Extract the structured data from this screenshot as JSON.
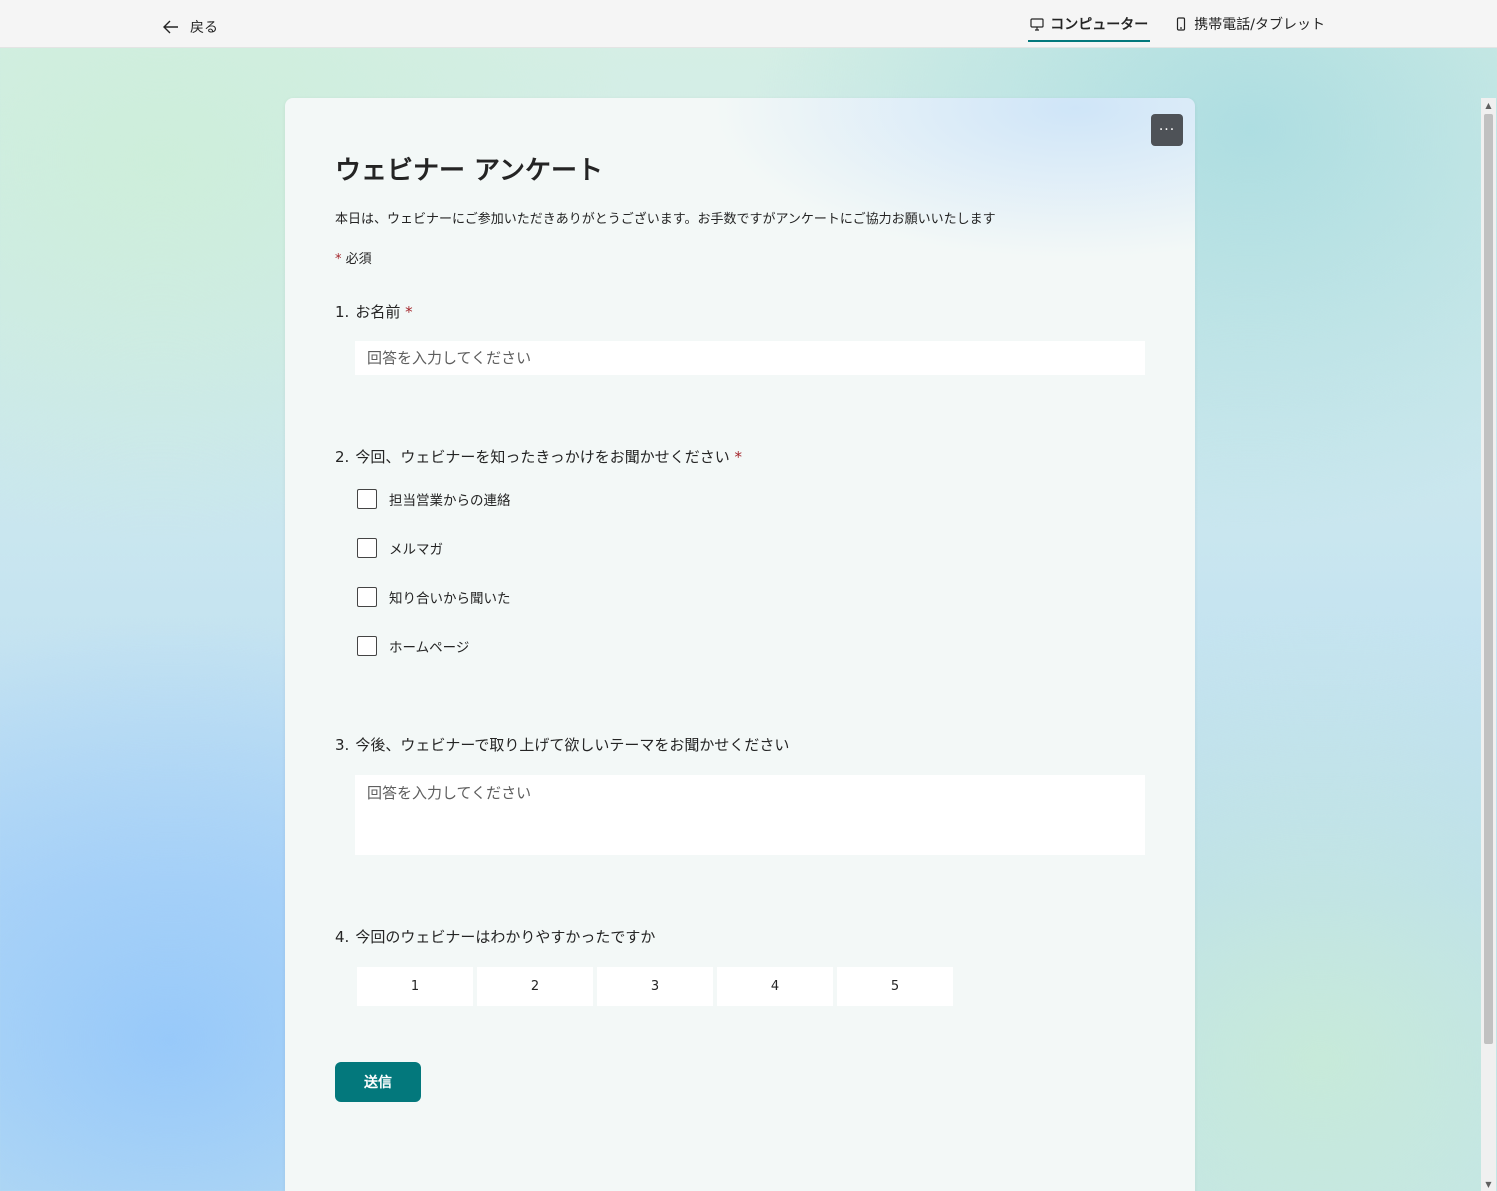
{
  "topbar": {
    "back_label": "戻る",
    "tabs": [
      {
        "label": "コンピューター",
        "icon": "monitor-icon",
        "active": true
      },
      {
        "label": "携帯電話/タブレット",
        "icon": "phone-icon",
        "active": false
      }
    ]
  },
  "form": {
    "more_label": "···",
    "title": "ウェビナー アンケート",
    "description": "本日は、ウェビナーにご参加いただきありがとうございます。お手数ですがアンケートにご協力お願いいたします",
    "required_star": "*",
    "required_note": "必須",
    "questions": [
      {
        "number": "1.",
        "text": "お名前",
        "required": "*",
        "type": "text",
        "placeholder": "回答を入力してください"
      },
      {
        "number": "2.",
        "text": "今回、ウェビナーを知ったきっかけをお聞かせください",
        "required": "*",
        "type": "checkbox",
        "options": [
          "担当営業からの連絡",
          "メルマガ",
          "知り合いから聞いた",
          "ホームページ"
        ]
      },
      {
        "number": "3.",
        "text": "今後、ウェビナーで取り上げて欲しいテーマをお聞かせください",
        "required": "",
        "type": "textarea",
        "placeholder": "回答を入力してください"
      },
      {
        "number": "4.",
        "text": "今回のウェビナーはわかりやすかったですか",
        "required": "",
        "type": "rating",
        "options": [
          "1",
          "2",
          "3",
          "4",
          "5"
        ]
      }
    ],
    "submit_label": "送信"
  },
  "colors": {
    "accent": "#03787c",
    "required": "#a4262c"
  }
}
